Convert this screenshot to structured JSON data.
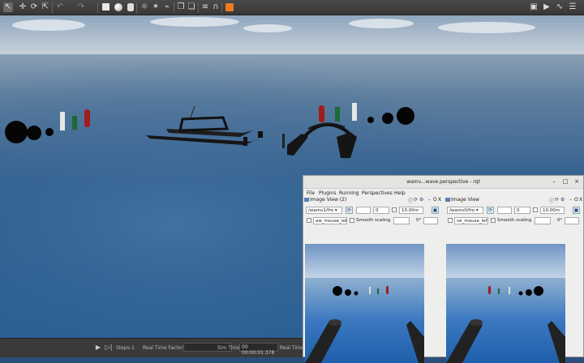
{
  "toolbar": {
    "icons": [
      "select-icon",
      "translate-icon",
      "rotate-icon",
      "scale-icon",
      "undo-icon",
      "redo-icon",
      "box-icon",
      "sphere-icon",
      "cylinder-icon",
      "sun-light-icon",
      "point-light-icon",
      "spot-light-icon",
      "copy-icon",
      "paste-icon",
      "align-icon",
      "snap-icon",
      "audio-icon",
      "orange-tool-icon"
    ],
    "right_icons": [
      "camera-icon",
      "video-icon",
      "plot-icon",
      "log-icon"
    ]
  },
  "statusbar": {
    "steps_label": "Steps:",
    "steps_value": "1",
    "real_time_factor_label": "Real Time Factor:",
    "real_time_factor_value": "",
    "sim_time_label": "Sim Time:",
    "sim_time_value": "00 00:00:01.378",
    "real_time_label": "Real Time:"
  },
  "rqt": {
    "title": "wamv...wave.perspective - rqt",
    "menus": [
      "File",
      "Plugins",
      "Running",
      "Perspectives",
      "Help"
    ],
    "panels": [
      {
        "title": "Image View (2)",
        "topic": "/wamv1/fro",
        "number": "0",
        "distance": "10.00m",
        "mouse_topic": "aw_mouse_left",
        "smooth_label": "Smooth scaling",
        "angle": "0°"
      },
      {
        "title": "Image View",
        "topic": "/wamv0/fro",
        "number": "0",
        "distance": "10.00m",
        "mouse_topic": "ve_mouse_left",
        "smooth_label": "Smooth scaling",
        "angle": "0°"
      }
    ]
  },
  "colors": {
    "toolbar": "#3f3f3f",
    "sky": "#b8c6d3",
    "ocean": "#2c5e91",
    "buoy_red": "#a11d1d",
    "buoy_green": "#1d6a35",
    "orange": "#f07a1c"
  }
}
